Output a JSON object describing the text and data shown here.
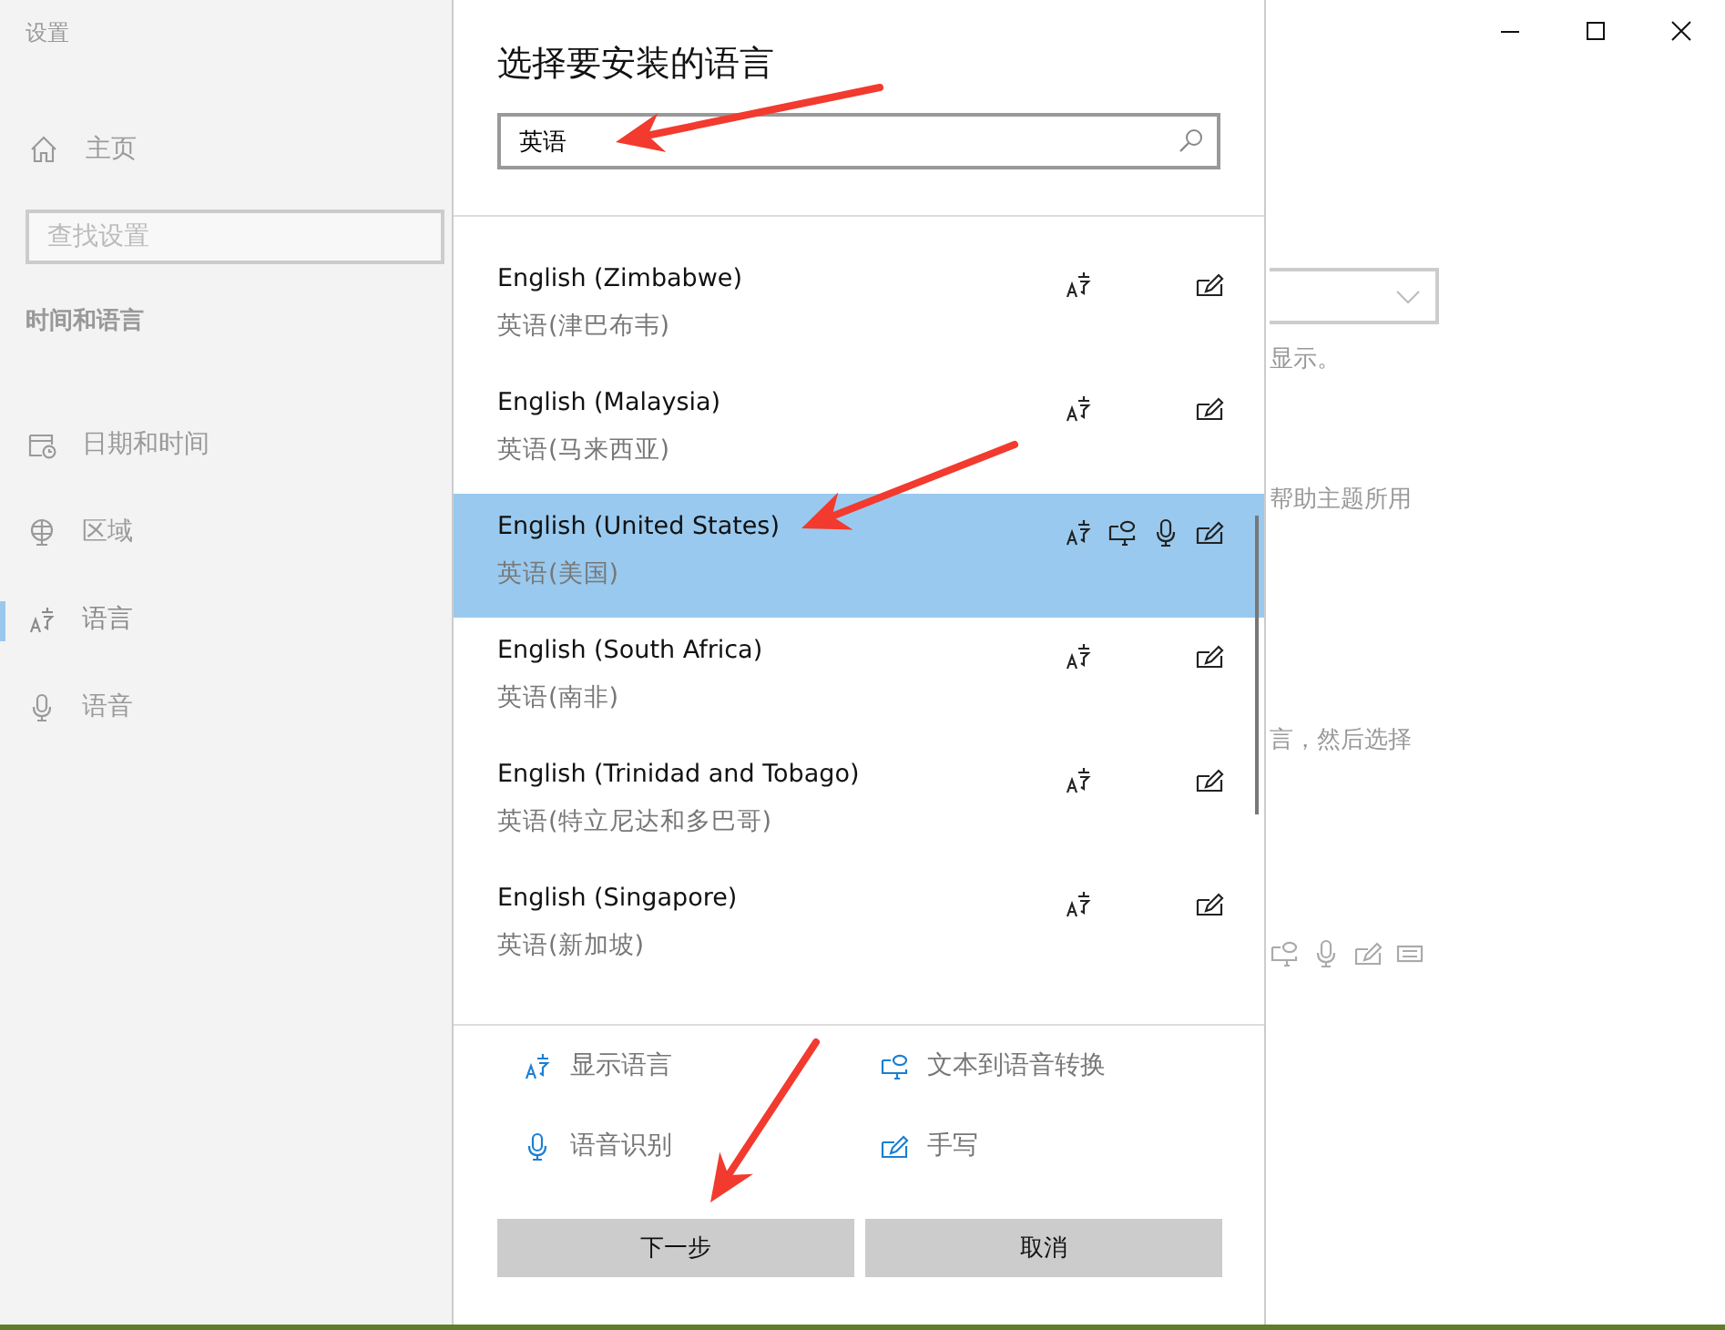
{
  "sidebar": {
    "title": "设置",
    "home": "主页",
    "search": {
      "placeholder": "查找设置"
    },
    "section": "时间和语言",
    "items": [
      {
        "label": "日期和时间",
        "selected": false
      },
      {
        "label": "区域",
        "selected": false
      },
      {
        "label": "语言",
        "selected": true
      },
      {
        "label": "语音",
        "selected": false
      }
    ]
  },
  "dialog": {
    "title": "选择要安装的语言",
    "search": {
      "value": "英语"
    },
    "languages": [
      {
        "name": "English (Zimbabwe)",
        "native": "英语(津巴布韦)",
        "features": {
          "display": true,
          "tts": false,
          "speech": false,
          "handwriting": true
        },
        "selected": false
      },
      {
        "name": "English (Malaysia)",
        "native": "英语(马来西亚)",
        "features": {
          "display": true,
          "tts": false,
          "speech": false,
          "handwriting": true
        },
        "selected": false
      },
      {
        "name": "English (United States)",
        "native": "英语(美国)",
        "features": {
          "display": true,
          "tts": true,
          "speech": true,
          "handwriting": true
        },
        "selected": true
      },
      {
        "name": "English (South Africa)",
        "native": "英语(南非)",
        "features": {
          "display": true,
          "tts": false,
          "speech": false,
          "handwriting": true
        },
        "selected": false
      },
      {
        "name": "English (Trinidad and Tobago)",
        "native": "英语(特立尼达和多巴哥)",
        "features": {
          "display": true,
          "tts": false,
          "speech": false,
          "handwriting": true
        },
        "selected": false
      },
      {
        "name": "English (Singapore)",
        "native": "英语(新加坡)",
        "features": {
          "display": true,
          "tts": false,
          "speech": false,
          "handwriting": true
        },
        "selected": false
      }
    ],
    "legend": [
      {
        "kind": "display",
        "label": "显示语言"
      },
      {
        "kind": "tts",
        "label": "文本到语音转换"
      },
      {
        "kind": "speech",
        "label": "语音识别"
      },
      {
        "kind": "handwriting",
        "label": "手写"
      }
    ],
    "buttons": [
      "下一步",
      "取消"
    ]
  },
  "background": {
    "texts": [
      "显示。",
      "帮助主题所用",
      "言，然后选择"
    ]
  },
  "annotations": [
    {
      "kind": "arrow"
    },
    {
      "kind": "arrow"
    },
    {
      "kind": "arrow"
    }
  ]
}
